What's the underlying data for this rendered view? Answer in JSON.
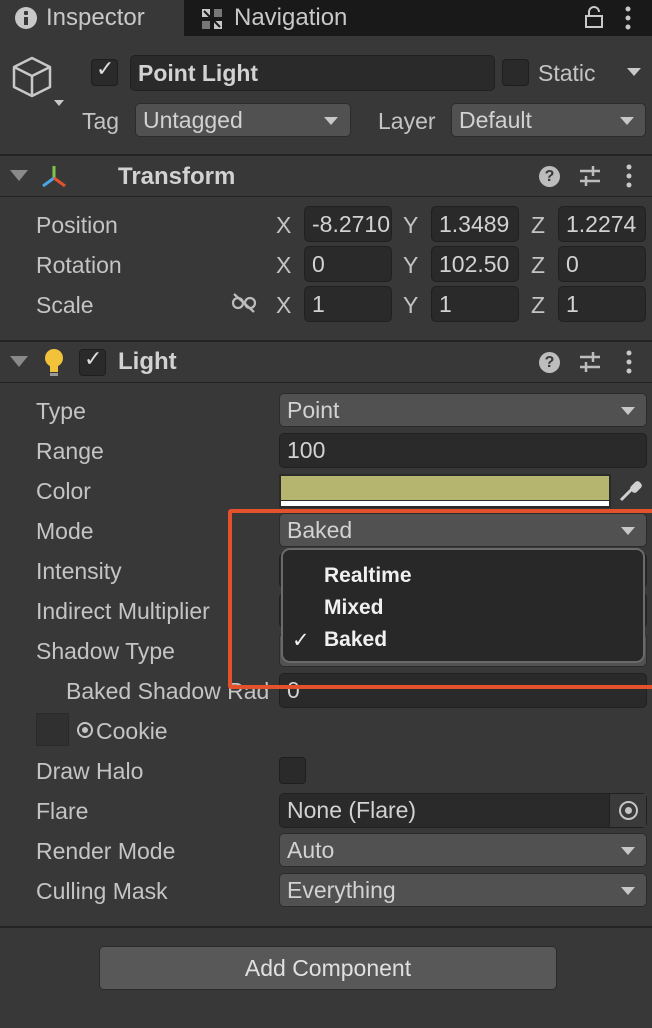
{
  "tabs": [
    {
      "label": "Inspector",
      "icon": "info-icon"
    },
    {
      "label": "Navigation",
      "icon": "navigation-icon"
    }
  ],
  "object": {
    "name": "Point Light",
    "active": true,
    "static_label": "Static",
    "static": false,
    "tag_label": "Tag",
    "tag_value": "Untagged",
    "layer_label": "Layer",
    "layer_value": "Default"
  },
  "transform": {
    "title": "Transform",
    "rows": [
      {
        "label": "Position",
        "x": "-8.2710",
        "y": "1.3489",
        "z": "1.2274"
      },
      {
        "label": "Rotation",
        "x": "0",
        "y": "102.50",
        "z": "0"
      },
      {
        "label": "Scale",
        "x": "1",
        "y": "1",
        "z": "1"
      }
    ],
    "axis": {
      "x": "X",
      "y": "Y",
      "z": "Z"
    }
  },
  "light": {
    "title": "Light",
    "enabled": true,
    "type_label": "Type",
    "type_value": "Point",
    "range_label": "Range",
    "range_value": "100",
    "color_label": "Color",
    "color_value": "#b5b56f",
    "mode_label": "Mode",
    "mode_value": "Baked",
    "intensity_label": "Intensity",
    "indirect_label": "Indirect Multiplier",
    "shadow_type_label": "Shadow Type",
    "baked_shadow_label": "Baked Shadow Radius",
    "baked_shadow_value": "0",
    "cookie_label": "Cookie",
    "draw_halo_label": "Draw Halo",
    "flare_label": "Flare",
    "flare_value": "None (Flare)",
    "render_mode_label": "Render Mode",
    "render_mode_value": "Auto",
    "culling_label": "Culling Mask",
    "culling_value": "Everything"
  },
  "mode_menu": {
    "options": [
      "Realtime",
      "Mixed",
      "Baked"
    ],
    "selected": "Baked",
    "check_glyph": "✓"
  },
  "add_component": "Add Component",
  "colors": {
    "highlight": "#e4512b",
    "background": "#383838"
  }
}
